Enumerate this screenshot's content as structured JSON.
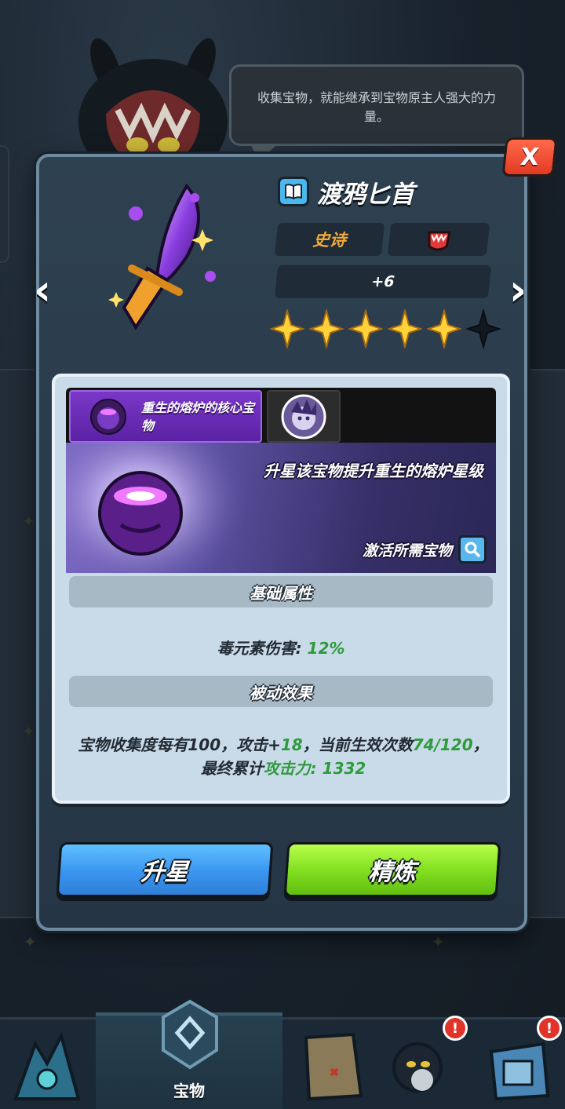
{
  "speech_text": "收集宝物，就能继承到宝物原主人强大的力量。",
  "close_label": "X",
  "nav_arrows": {
    "prev": "‹",
    "next": "›"
  },
  "item": {
    "name": "渡鸦匕首",
    "rarity": "史诗",
    "level": "+6",
    "stars_filled": 5,
    "stars_total": 6
  },
  "tabs": [
    {
      "label": "重生的熔炉的核心宝物",
      "active": true
    },
    {
      "label": "",
      "active": false
    }
  ],
  "banner": {
    "text": "升星该宝物提升重生的熔炉星级",
    "link": "激活所需宝物"
  },
  "base_attr": {
    "header": "基础属性",
    "stat_name": "毒元素伤害: ",
    "stat_value": "12%"
  },
  "passive": {
    "header": "被动效果",
    "part1": "宝物收集度每有100，攻击+",
    "value1": "18",
    "part2": "，当前生效次数",
    "count": "74/120",
    "part3": "，最终累计",
    "total_label": "攻击力: 1332"
  },
  "buttons": {
    "star_up": "升星",
    "refine": "精炼"
  },
  "bottom_nav": {
    "active_label": "宝物",
    "badges": [
      "!",
      "!"
    ]
  },
  "colors": {
    "rarity": "#f1a93a",
    "highlight_green": "#2e9b3c",
    "btn_blue": "#3a95f0",
    "btn_green": "#7fdc1f",
    "close_red": "#e23a24",
    "star_gold": "#ffd23a"
  }
}
